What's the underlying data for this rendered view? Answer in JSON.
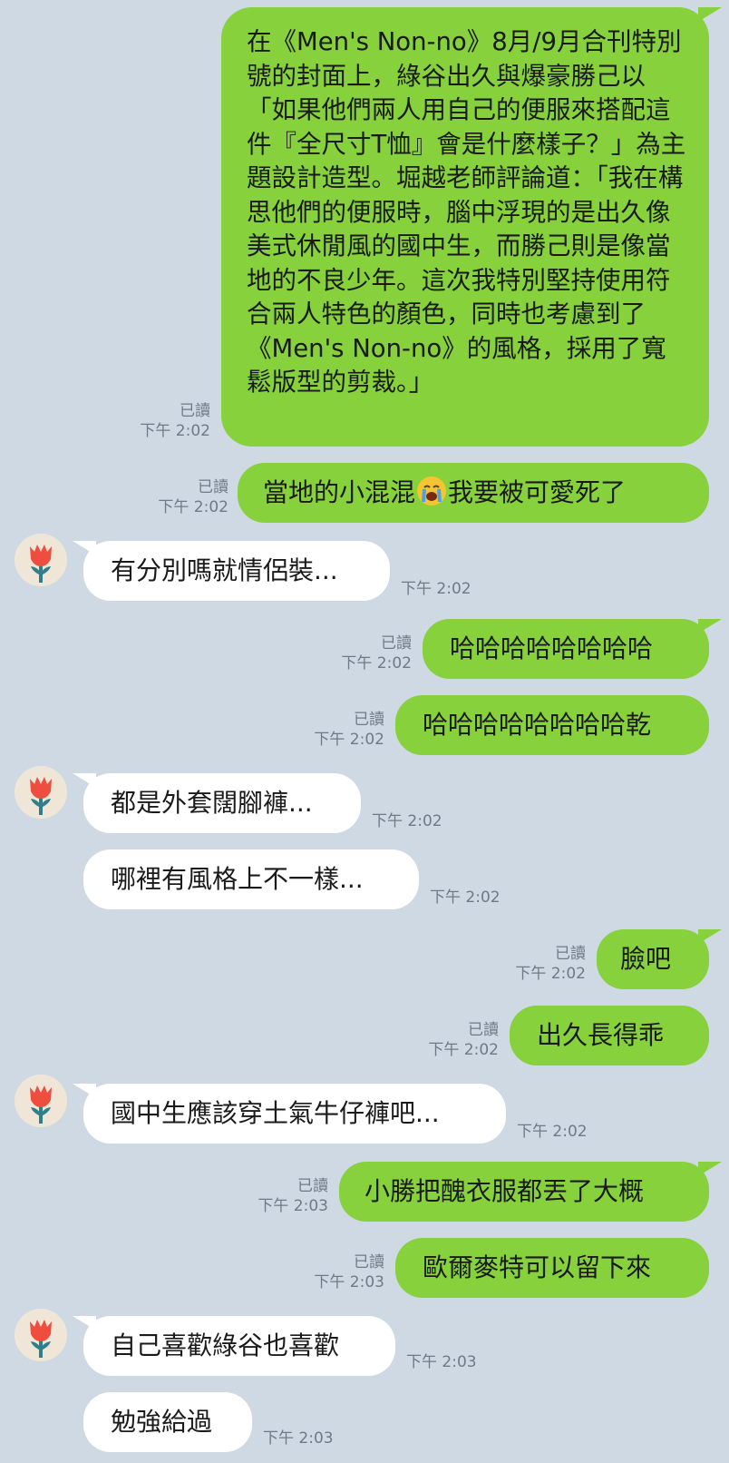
{
  "messages": [
    {
      "side": "out",
      "read": "已讀",
      "time": "下午 2:02",
      "text": "在《Men's Non-no》8月/9月合刊特別號的封面上，綠谷出久與爆豪勝己以「如果他們兩人用自己的便服來搭配這件『全尺寸T恤』會是什麼樣子？」為主題設計造型。堀越老師評論道：「我在構思他們的便服時，腦中浮現的是出久像美式休閒風的國中生，而勝己則是像當地的不良少年。這次我特別堅持使用符合兩人特色的顏色，同時也考慮到了《Men's Non-no》的風格，採用了寬鬆版型的剪裁。」"
    },
    {
      "side": "out",
      "read": "已讀",
      "time": "下午 2:02",
      "text_before": "當地的小混混",
      "emoji": "loudly-crying-face-emoji",
      "text_after": "我要被可愛死了"
    },
    {
      "side": "in",
      "time": "下午 2:02",
      "text": "有分別嗎就情侶裝..."
    },
    {
      "side": "out",
      "read": "已讀",
      "time": "下午 2:02",
      "text": "哈哈哈哈哈哈哈哈"
    },
    {
      "side": "out",
      "read": "已讀",
      "time": "下午 2:02",
      "text": "哈哈哈哈哈哈哈哈乾"
    },
    {
      "side": "in",
      "time": "下午 2:02",
      "text": "都是外套闊腳褲..."
    },
    {
      "side": "in",
      "time": "下午 2:02",
      "text": "哪裡有風格上不一樣..."
    },
    {
      "side": "out",
      "read": "已讀",
      "time": "下午 2:02",
      "text": "臉吧"
    },
    {
      "side": "out",
      "read": "已讀",
      "time": "下午 2:02",
      "text": "出久長得乖"
    },
    {
      "side": "in",
      "time": "下午 2:02",
      "text": "國中生應該穿土氣牛仔褲吧..."
    },
    {
      "side": "out",
      "read": "已讀",
      "time": "下午 2:03",
      "text": "小勝把醜衣服都丟了大概"
    },
    {
      "side": "out",
      "read": "已讀",
      "time": "下午 2:03",
      "text": "歐爾麥特可以留下來"
    },
    {
      "side": "in",
      "time": "下午 2:03",
      "text": "自己喜歡綠谷也喜歡"
    },
    {
      "side": "in",
      "time": "下午 2:03",
      "text": "勉強給過"
    }
  ],
  "colors": {
    "background": "#cfd9e3",
    "outgoing": "#86d13c",
    "incoming": "#ffffff"
  },
  "avatar_icon": "red-flower-icon"
}
